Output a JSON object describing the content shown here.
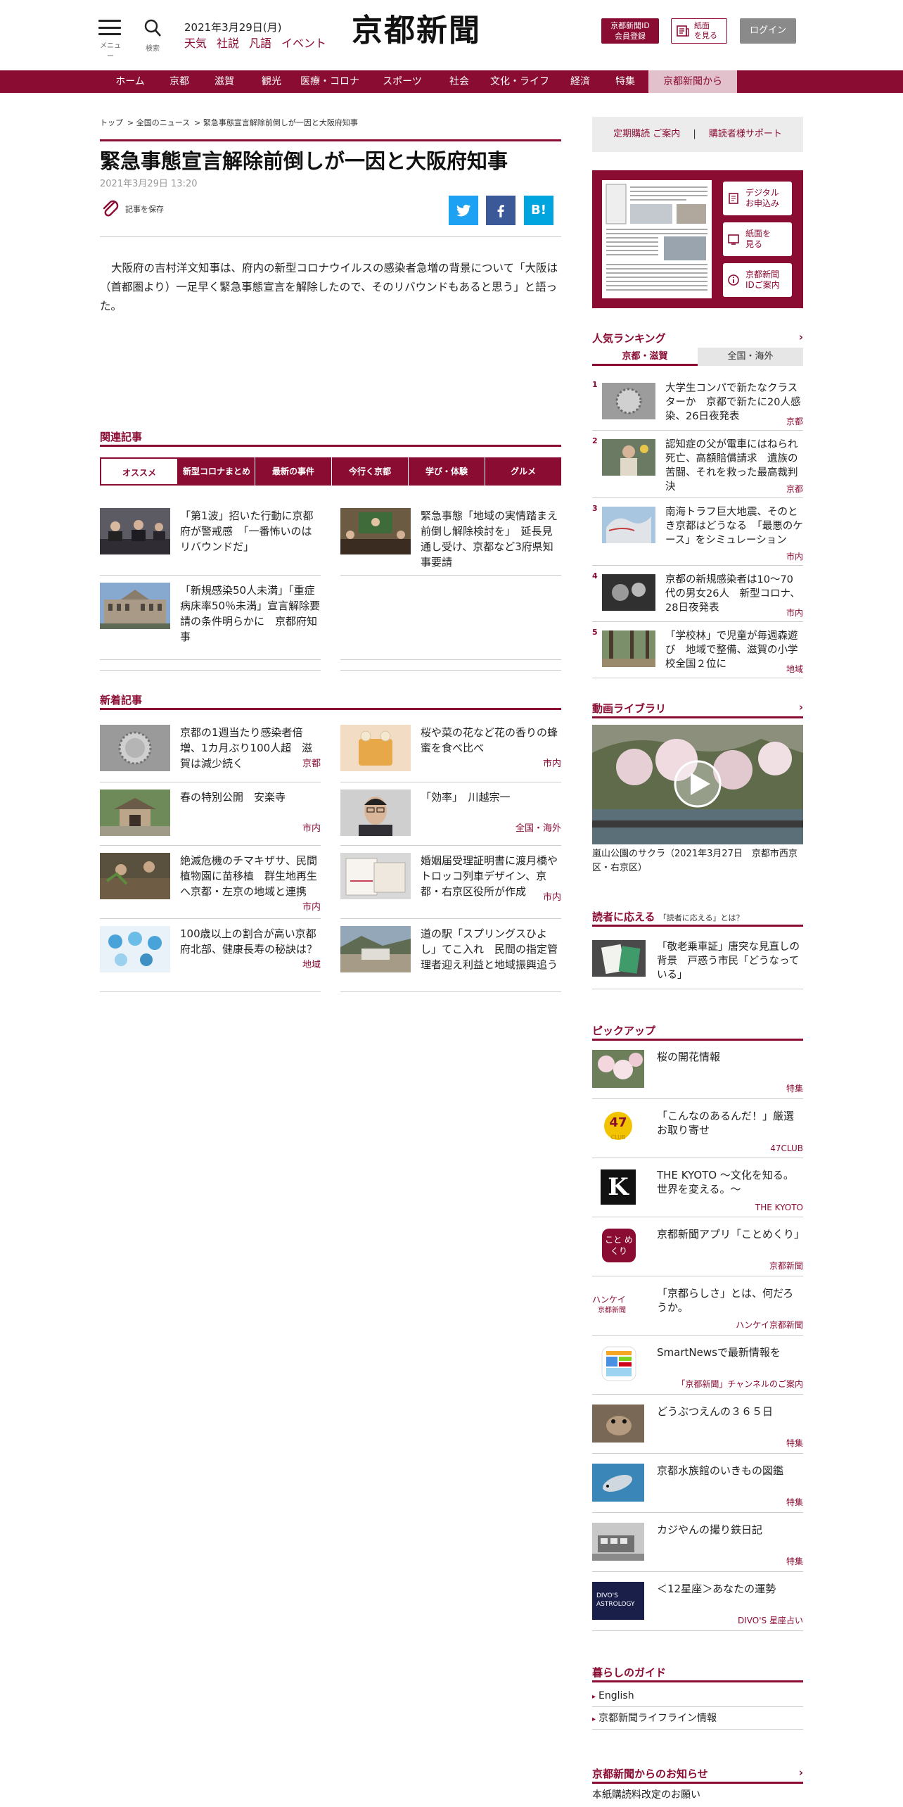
{
  "header": {
    "menu_caption": "メニュー",
    "search_caption": "検索",
    "date": "2021年3月29日(月)",
    "links": [
      "天気",
      "社説",
      "凡語",
      "イベント"
    ],
    "logo": "京都新聞",
    "member_line1": "京都新聞ID",
    "member_line2": "会員登録",
    "paper_line1": "紙面",
    "paper_line2": "を見る",
    "login": "ログイン"
  },
  "nav": [
    "ホーム",
    "京都",
    "滋賀",
    "観光",
    "医療・コロナ",
    "スポーツ",
    "社会",
    "文化・ライフ",
    "経済",
    "特集",
    "京都新聞から"
  ],
  "breadcrumb": [
    "トップ",
    "> 全国のニュース",
    "> 緊急事態宣言解除前倒しが一因と大阪府知事"
  ],
  "article": {
    "title": "緊急事態宣言解除前倒しが一因と大阪府知事",
    "date": "2021年3月29日 13:20",
    "save_label": "記事を保存",
    "share_hatena": "B!",
    "body": "大阪府の吉村洋文知事は、府内の新型コロナウイルスの感染者急増の背景について「大阪は（首都圏より）一足早く緊急事態宣言を解除したので、そのリバウンドもあると思う」と語った。"
  },
  "related": {
    "heading": "関連記事",
    "tabs": [
      "オススメ",
      "新型コロナまとめ",
      "最新の事件",
      "今行く京都",
      "学び・体験",
      "グルメ"
    ],
    "items": [
      {
        "title": "「第1波」招いた行動に京都府が警戒感　「一番怖いのはリバウンドだ」"
      },
      {
        "title": "緊急事態「地域の実情踏まえ前倒し解除検討を」　延長見通し受け、京都など3府県知事要請"
      },
      {
        "title": "「新規感染50人未満」「重症病床率50％未満」宣言解除要請の条件明らかに　京都府知事"
      }
    ]
  },
  "latest": {
    "heading": "新着記事",
    "items": [
      {
        "title": "京都の1週当たり感染者倍増、1カ月ぶり100人超　滋賀は減少続く",
        "cat": "京都"
      },
      {
        "title": "桜や菜の花など花の香りの蜂蜜を食べ比べ",
        "cat": "市内"
      },
      {
        "title": "春の特別公開　安楽寺",
        "cat": "市内"
      },
      {
        "title": "「効率」　川越宗一",
        "cat": "全国・海外"
      },
      {
        "title": "絶滅危機のチマキザサ、民間植物園に苗移植　群生地再生へ京都・左京の地域と連携",
        "cat": "市内"
      },
      {
        "title": "婚姻届受理証明書に渡月橋やトロッコ列車デザイン、京都・右京区役所が作成",
        "cat": "市内"
      },
      {
        "title": "100歳以上の割合が高い京都府北部、健康長寿の秘訣は？",
        "cat": "地域"
      },
      {
        "title": "道の駅「スプリングスひよし」てこ入れ　民間の指定管理者迎え利益と地域振興追う",
        "cat": ""
      }
    ]
  },
  "sidebar": {
    "subscribe": "定期購読 ご案内",
    "divider": "|",
    "support": "購読者様サポート",
    "paper_buttons": [
      {
        "l1": "デジタル",
        "l2": "お申込み"
      },
      {
        "l1": "紙面を",
        "l2": "見る"
      },
      {
        "l1": "京都新聞",
        "l2": "IDご案内"
      }
    ],
    "ranking": {
      "heading": "人気ランキング",
      "arrow": "›",
      "tabs": [
        "京都・滋賀",
        "全国・海外"
      ],
      "items": [
        {
          "n": "1",
          "title": "大学生コンパで新たなクラスターか　京都で新たに20人感染、26日夜発表",
          "cat": "京都"
        },
        {
          "n": "2",
          "title": "認知症の父が電車にはねられ死亡、高額賠償請求　遺族の苦闘、それを救った最高裁判決",
          "cat": "京都"
        },
        {
          "n": "3",
          "title": "南海トラフ巨大地震、そのとき京都はどうなる　「最悪のケース」をシミュレーション",
          "cat": "市内"
        },
        {
          "n": "4",
          "title": "京都の新規感染者は10～70代の男女26人　新型コロナ、28日夜発表",
          "cat": "市内"
        },
        {
          "n": "5",
          "title": "「学校林」で児童が毎週森遊び　地域で整備、滋賀の小学校全国２位に",
          "cat": "地域"
        }
      ]
    },
    "video": {
      "heading": "動画ライブラリ",
      "arrow": "›",
      "caption": "嵐山公園のサクラ（2021年3月27日　京都市西京区・右京区）"
    },
    "reader": {
      "heading": "読者に応える",
      "sub": "「読者に応える」とは？",
      "title": "「敬老乗車証」唐突な見直しの背景　戸惑う市民「どうなっている」"
    },
    "pickup": {
      "heading": "ピックアップ",
      "items": [
        {
          "title": "桜の開花情報",
          "cat": "特集"
        },
        {
          "title": "「こんなのあるんだ！」厳選お取り寄せ",
          "cat": "47CLUB"
        },
        {
          "title": "THE KYOTO ～文化を知る。世界を変える。～",
          "cat": "THE KYOTO"
        },
        {
          "title": "京都新聞アプリ「ことめくり」",
          "cat": "京都新聞"
        },
        {
          "title": "「京都らしさ」とは、何だろうか。",
          "cat": "ハンケイ京都新聞"
        },
        {
          "title": "SmartNewsで最新情報を",
          "cat": "「京都新聞」チャンネルのご案内"
        },
        {
          "title": "どうぶつえんの３６５日",
          "cat": "特集"
        },
        {
          "title": "京都水族館のいきもの図鑑",
          "cat": "特集"
        },
        {
          "title": "カジやんの撮り鉄日記",
          "cat": "特集"
        },
        {
          "title": "＜12星座＞あなたの運勢",
          "cat": "DIVO'S 星座占い"
        }
      ],
      "logo_47": "47",
      "logo_47_sub": "CLUB",
      "logo_k": "K",
      "logo_kotomekuri": "こと めくり",
      "logo_hankei1": "ハンケイ",
      "logo_hankei2": "京都新聞",
      "logo_divos1": "DIVO'S",
      "logo_divos2": "ASTROLOGY"
    },
    "guide": {
      "heading": "暮らしのガイド",
      "items": [
        "English",
        "京都新聞ライフライン情報"
      ]
    },
    "notice": {
      "heading": "京都新聞からのお知らせ",
      "arrow": "›",
      "first": "本紙購読料改定のお願い"
    }
  },
  "colors": {
    "brand": "#8a0c33",
    "brand_light": "#e3c1cc",
    "twitter": "#1da1f2",
    "facebook": "#3b5998",
    "hatena": "#00a4de"
  }
}
